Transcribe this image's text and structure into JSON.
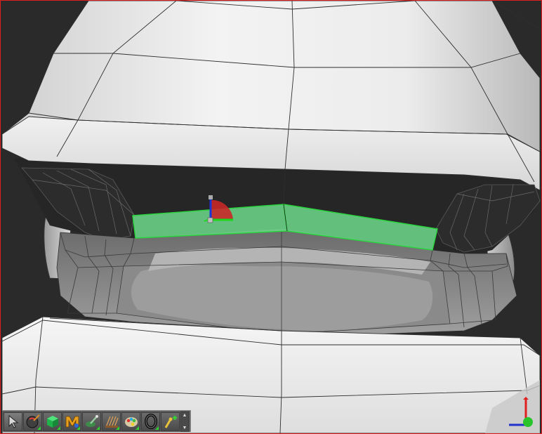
{
  "viewport": {
    "border_color": "#e02020",
    "background": "#2a2a2a",
    "selection_color": "#6fdc8c",
    "selection_edge_color": "#29d63d"
  },
  "gizmo": {
    "icon": "transform-gizmo-icon",
    "axis_colors": {
      "x": "#1bd61b",
      "y": "#1a34d8",
      "z": "#d93030"
    }
  },
  "view_axis": {
    "icon": "view-orientation-axis-icon",
    "axis_colors": {
      "up": "#e02020",
      "right": "#29c42b",
      "depth": "#2233cc"
    }
  },
  "toolbar": {
    "tools": [
      {
        "name": "select-tool",
        "icon": "arrow-cursor-icon"
      },
      {
        "name": "object-tool",
        "icon": "paint-sphere-icon"
      },
      {
        "name": "cube-primitive-tool",
        "icon": "cube-icon"
      },
      {
        "name": "material-tool",
        "icon": "material-m-icon"
      },
      {
        "name": "sculpt-tool",
        "icon": "sculpt-brush-icon"
      },
      {
        "name": "hair-tool",
        "icon": "hair-comb-icon"
      },
      {
        "name": "color-palette-tool",
        "icon": "palette-icon"
      },
      {
        "name": "ring-tool",
        "icon": "ring-icon"
      },
      {
        "name": "add-joint-tool",
        "icon": "joint-add-icon"
      }
    ]
  }
}
